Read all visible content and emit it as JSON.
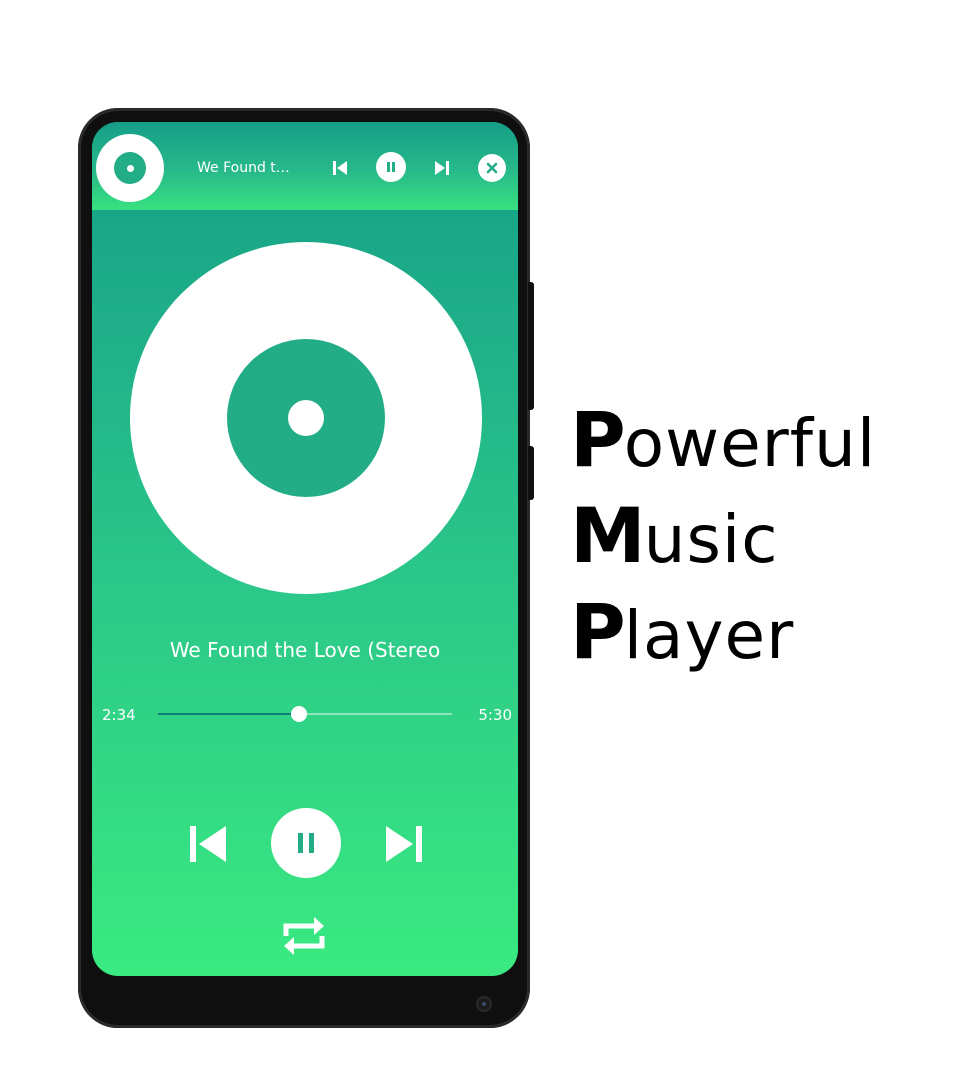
{
  "mini_player": {
    "title": "We Found th...",
    "icons": {
      "disc": "disc-icon",
      "prev": "skip-previous-icon",
      "play_pause": "pause-icon",
      "next": "skip-next-icon",
      "close": "close-icon"
    }
  },
  "now_playing": {
    "title": "We Found the Love (Stereo",
    "elapsed": "2:34",
    "total": "5:30",
    "progress": 0.48
  },
  "controls": {
    "icons": {
      "prev": "skip-previous-icon",
      "play_pause": "pause-icon",
      "next": "skip-next-icon",
      "repeat": "repeat-icon"
    }
  },
  "headline": {
    "line1_cap": "P",
    "line1_rest": "owerful",
    "line2_cap": "M",
    "line2_rest": "usic",
    "line3_cap": "P",
    "line3_rest": "layer"
  },
  "colors": {
    "accent": "#23ad86",
    "gradient_top": "#139f87",
    "gradient_bottom": "#3aea80",
    "progress_fill": "#0f7d78"
  }
}
